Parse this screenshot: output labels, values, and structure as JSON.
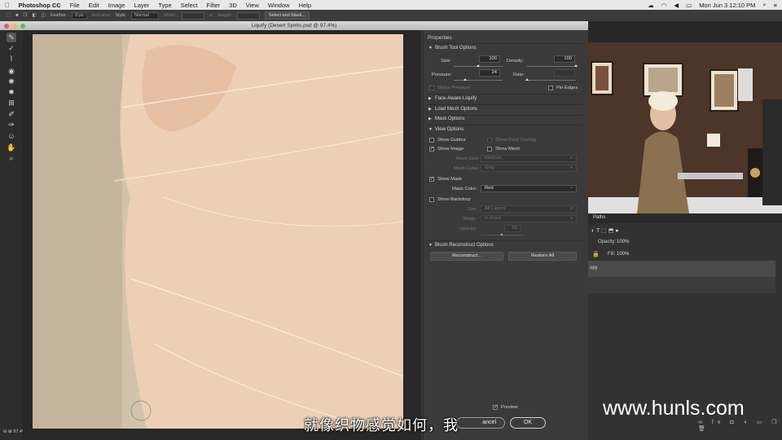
{
  "menubar": {
    "app": "Photoshop CC",
    "items": [
      "File",
      "Edit",
      "Image",
      "Layer",
      "Type",
      "Select",
      "Filter",
      "3D",
      "View",
      "Window",
      "Help"
    ],
    "clock": "Mon Jun 3  12:10 PM"
  },
  "optionsbar": {
    "feather_label": "Feather:",
    "feather_value": "0 px",
    "antialias": "Anti-alias",
    "style_label": "Style:",
    "style_value": "Normal",
    "width_label": "Width:",
    "height_label": "Height:",
    "select_mask": "Select and Mask..."
  },
  "liquify": {
    "title": "Liquify (Desert Spirits.psd @ 97.4%)",
    "zoom": "97.4%"
  },
  "props": {
    "title": "Properties",
    "brush_tool_options": "Brush Tool Options",
    "size_label": "Size:",
    "size_value": "100",
    "density_label": "Density:",
    "density_value": "100",
    "pressure_label": "Pressure:",
    "pressure_value": "24",
    "rate_label": "Rate:",
    "rate_value": "",
    "stylus_pressure": "Stylus Pressure",
    "pin_edges": "Pin Edges",
    "face_aware": "Face-Aware Liquify",
    "load_mesh": "Load Mesh Options",
    "mask_options": "Mask Options",
    "view_options": "View Options",
    "show_guides": "Show Guides",
    "show_face_overlay": "Show Face Overlay",
    "show_image": "Show Image",
    "show_mesh": "Show Mesh",
    "mesh_size_label": "Mesh Size:",
    "mesh_size_value": "Medium",
    "mesh_color_label": "Mesh Color:",
    "mesh_color_value": "Gray",
    "show_mask": "Show Mask",
    "mask_color_label": "Mask Color:",
    "mask_color_value": "Red",
    "show_backdrop": "Show Backdrop",
    "use_label": "Use:",
    "use_value": "All Layers",
    "mode_label": "Mode:",
    "mode_value": "In Front",
    "opacity_label": "Opacity:",
    "opacity_value": "50",
    "brush_reconstruct": "Brush Reconstruct Options",
    "reconstruct": "Reconstruct...",
    "restore_all": "Restore All",
    "preview": "Preview",
    "cancel": "ancel",
    "ok": "OK",
    "size_level": 0.5,
    "density_level": 1.0,
    "pressure_level": 0.24,
    "rate_level": 0.0
  },
  "rightpanel": {
    "tab_paths": "Paths",
    "opacity_label": "Opacity:",
    "opacity_value": "100%",
    "fill_label": "Fill:",
    "fill_value": "100%",
    "layer_name": "opy"
  },
  "overlay": {
    "subtitle": "就像织物感觉如何，我",
    "watermark": "www.hunls.com"
  }
}
